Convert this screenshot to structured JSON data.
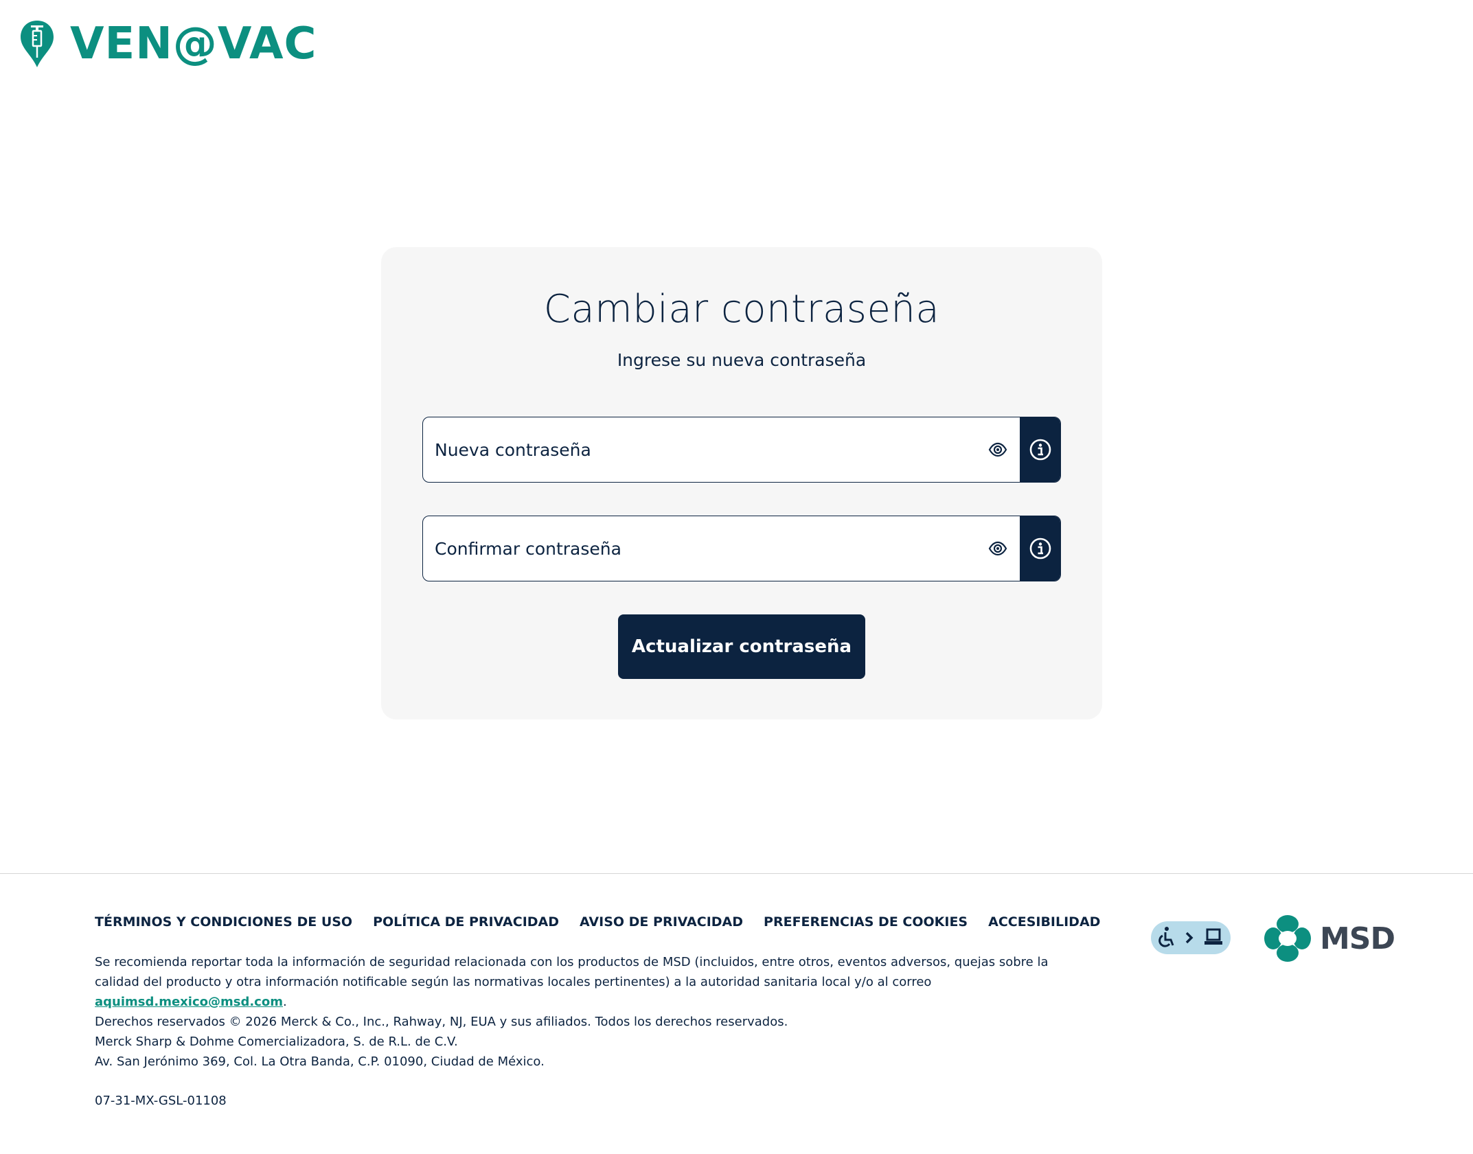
{
  "brand": {
    "logo_text": "VEN@VAC",
    "accent_color": "#0c8f80",
    "navy_color": "#0c2340"
  },
  "form": {
    "title": "Cambiar contraseña",
    "subtitle": "Ingrese su nueva contraseña",
    "new_password": {
      "placeholder": "Nueva contraseña",
      "value": ""
    },
    "confirm_password": {
      "placeholder": "Confirmar contraseña",
      "value": ""
    },
    "submit_label": "Actualizar contraseña",
    "icons": {
      "toggle": "eye-icon",
      "help": "info-icon"
    }
  },
  "footer": {
    "links": [
      "TÉRMINOS Y CONDICIONES DE USO",
      "POLÍTICA DE PRIVACIDAD",
      "AVISO DE PRIVACIDAD",
      "PREFERENCIAS DE COOKIES",
      "ACCESIBILIDAD"
    ],
    "notice_text": "Se recomienda reportar toda la información de seguridad relacionada con los productos de MSD (incluidos, entre otros, eventos adversos, quejas sobre la calidad del producto y otra información notificable según las normativas locales pertinentes) a la autoridad sanitaria local y/o al correo ",
    "notice_email": "aquimsd.mexico@msd.com",
    "notice_end": ".",
    "copyright_lines": [
      "Derechos reservados © 2026 Merck & Co., Inc., Rahway, NJ, EUA y sus afiliados. Todos los derechos reservados.",
      "Merck Sharp & Dohme Comercializadora, S. de R.L. de C.V.",
      "Av. San Jerónimo 369, Col. La Otra Banda, C.P. 01090, Ciudad de México."
    ],
    "code": "07-31-MX-GSL-01108",
    "accessibility_badge_icon": "accessibility-icon",
    "company_logo_text": "MSD"
  }
}
